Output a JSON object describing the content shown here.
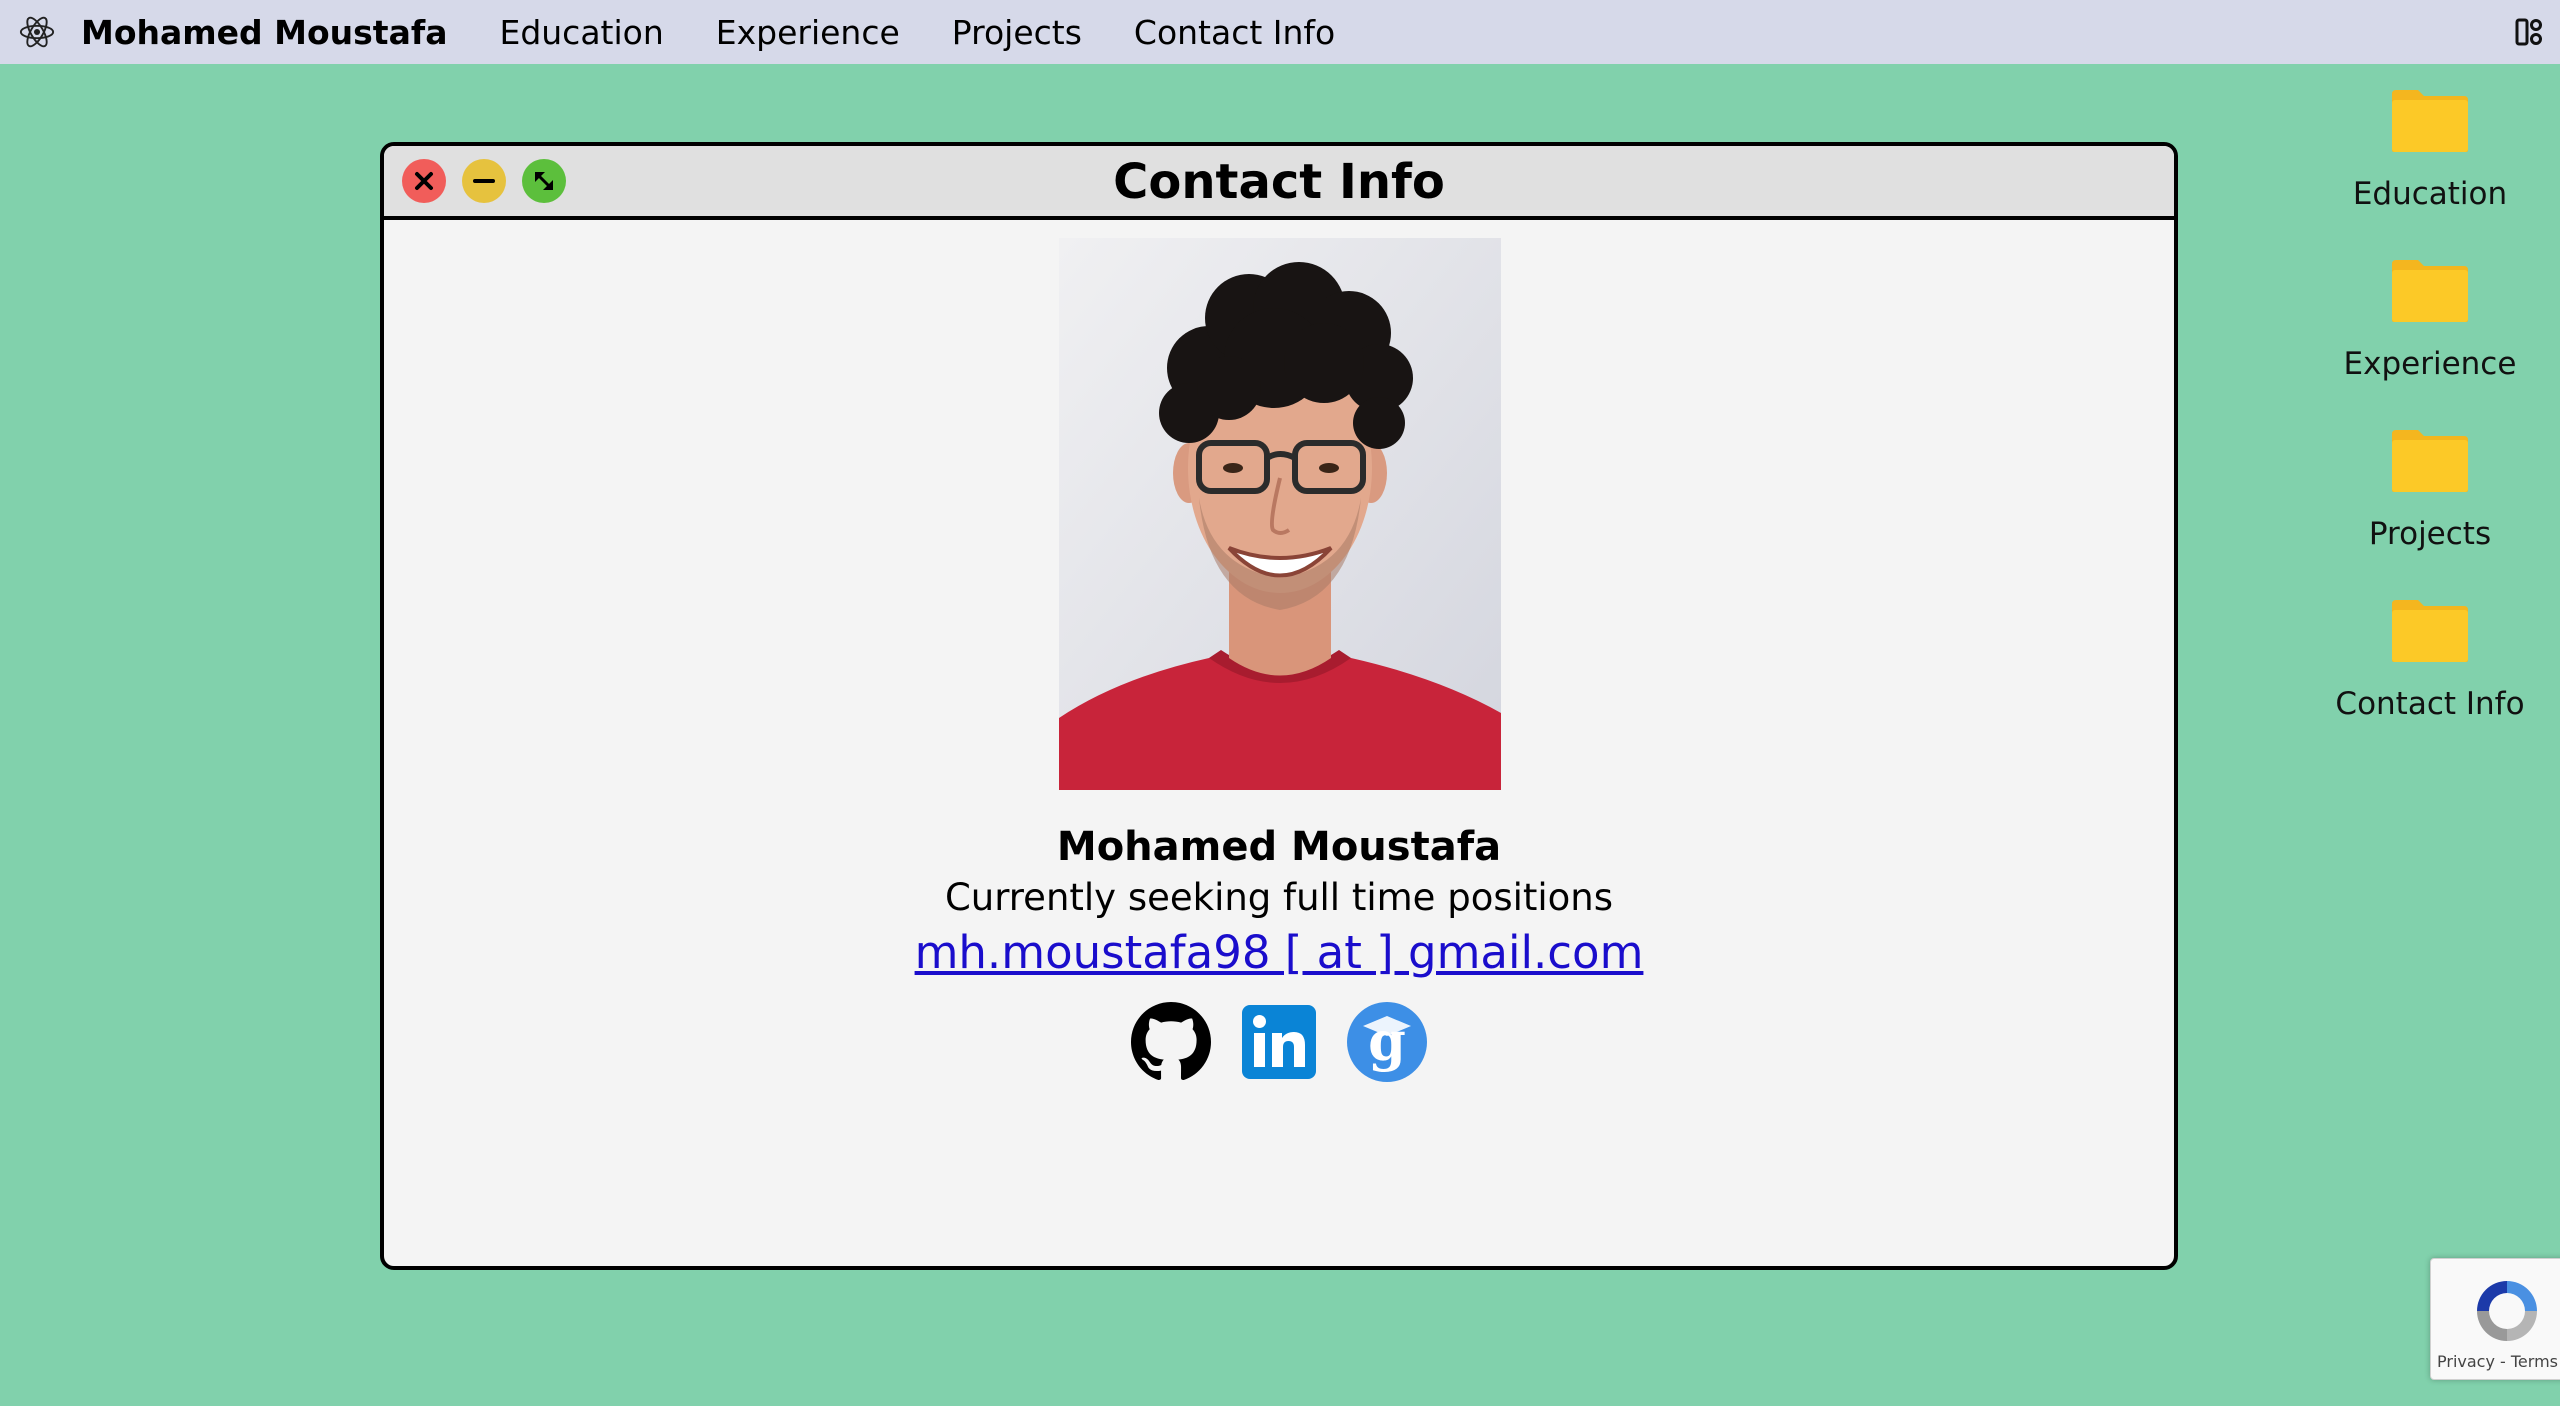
{
  "menubar": {
    "brand": "Mohamed Moustafa",
    "items": [
      {
        "label": "Education"
      },
      {
        "label": "Experience"
      },
      {
        "label": "Projects"
      },
      {
        "label": "Contact Info"
      }
    ]
  },
  "window": {
    "title": "Contact Info"
  },
  "contact": {
    "name": "Mohamed Moustafa",
    "tagline": "Currently seeking full time positions",
    "email": "mh.moustafa98 [ at ] gmail.com"
  },
  "socials": [
    {
      "icon": "github-icon"
    },
    {
      "icon": "linkedin-icon"
    },
    {
      "icon": "google-scholar-icon"
    }
  ],
  "desktop": {
    "items": [
      {
        "label": "Education"
      },
      {
        "label": "Experience"
      },
      {
        "label": "Projects"
      },
      {
        "label": "Contact Info"
      }
    ]
  },
  "recaptcha": {
    "links": "Privacy - Terms"
  },
  "colors": {
    "background": "#81d1ac",
    "menubar": "#d6d9e9",
    "folder": "#fcc927",
    "close": "#f15d5a",
    "minimize": "#e6c23e",
    "maximize": "#5cbf3c",
    "link": "#1a0dcc",
    "linkedin": "#0a84d6",
    "scholar": "#3d8fe6"
  }
}
